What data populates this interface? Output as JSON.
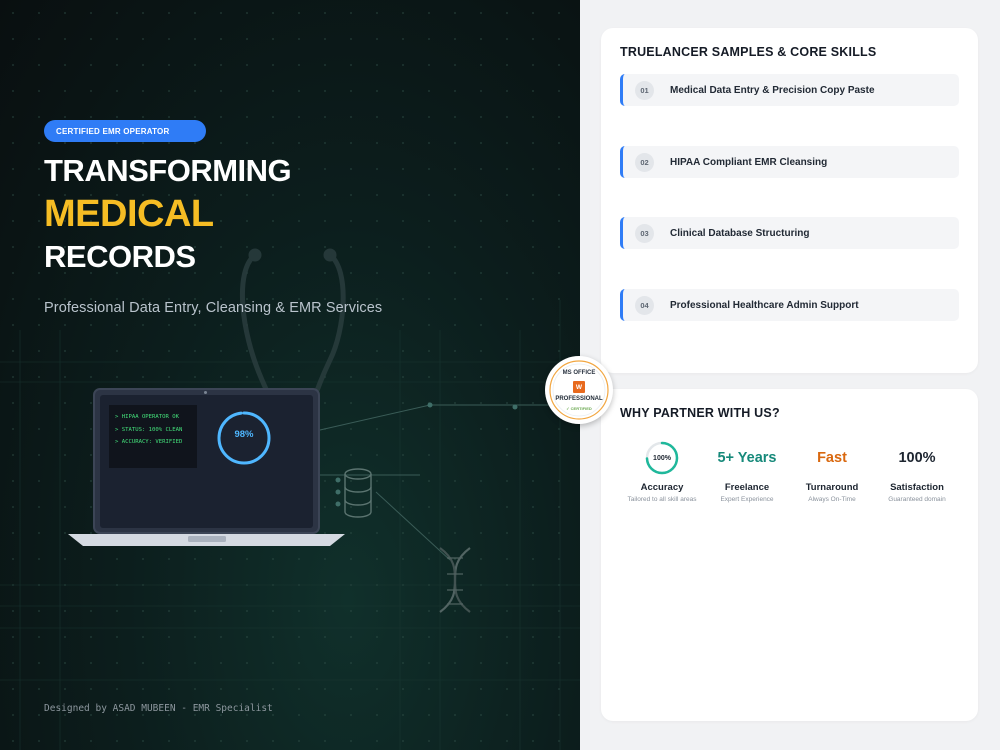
{
  "hero": {
    "badge": "CERTIFIED EMR OPERATOR",
    "headline_line1": "TRANSFORMING",
    "headline_line2": "MEDICAL",
    "headline_line3": "RECORDS",
    "subtitle": "Professional Data Entry, Cleansing & EMR Services",
    "credit": "Designed by ASAD MUBEEN - EMR Specialist",
    "terminal_lines": [
      "> HIPAA OPERATOR OK",
      "> STATUS: 100% CLEAN",
      "> ACCURACY: VERIFIED"
    ],
    "gauge_label": "98%",
    "gauge_value": 0.98
  },
  "seal": {
    "top": "MS OFFICE",
    "letter": "W",
    "middle": "PROFESSIONAL",
    "bottom": "✓ CERTIFIED"
  },
  "skills": {
    "title": "TRUELANCER SAMPLES & CORE SKILLS",
    "items": [
      {
        "num": "01",
        "label": "Medical Data Entry & Precision Copy Paste"
      },
      {
        "num": "02",
        "label": "HIPAA Compliant EMR Cleansing"
      },
      {
        "num": "03",
        "label": "Clinical Database Structuring"
      },
      {
        "num": "04",
        "label": "Professional Healthcare Admin Support"
      }
    ]
  },
  "why": {
    "title": "WHY PARTNER WITH US?",
    "stats": [
      {
        "value": "100%",
        "label": "Accuracy",
        "sub": "Tailored to all skill areas",
        "color": "#1d2530"
      },
      {
        "value": "5+ Years",
        "label": "Freelance",
        "sub": "Expert Experience",
        "color": "#16897a"
      },
      {
        "value": "Fast",
        "label": "Turnaround",
        "sub": "Always On-Time",
        "color": "#d9680f"
      },
      {
        "value": "100%",
        "label": "Satisfaction",
        "sub": "Guaranteed domain",
        "color": "#1d2530"
      }
    ]
  },
  "colors": {
    "accent_blue": "#2f7cf6",
    "accent_yellow": "#f6bd24",
    "terminal_green": "#43e07a",
    "ring_teal": "#1fb89b"
  }
}
